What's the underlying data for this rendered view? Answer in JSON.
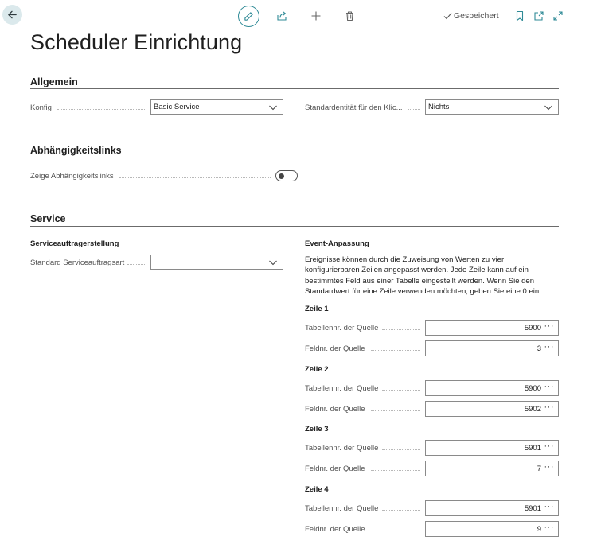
{
  "toolbar": {
    "saved_label": "Gespeichert"
  },
  "page": {
    "title": "Scheduler Einrichtung"
  },
  "sections": {
    "allgemein": {
      "title": "Allgemein",
      "konfig_label": "Konfig",
      "konfig_value": "Basic Service",
      "entity_label": "Standardentität für den Klic...",
      "entity_value": "Nichts"
    },
    "dependencies": {
      "title": "Abhängigkeitslinks",
      "show_label": "Zeige Abhängigkeitslinks",
      "show_value": false
    },
    "service": {
      "title": "Service",
      "order_heading": "Serviceauftragerstellung",
      "order_type_label": "Standard Serviceauftragsart",
      "order_type_value": "",
      "event_heading": "Event-Anpassung",
      "event_description": "Ereignisse können durch die Zuweisung von Werten zu vier konfigurierbaren Zeilen angepasst werden. Jede Zeile kann auf ein bestimmtes Feld aus einer Tabelle eingestellt werden. Wenn Sie den Standardwert für eine Zeile verwenden möchten, geben Sie eine 0 ein.",
      "rows": [
        {
          "heading": "Zeile 1",
          "table_label": "Tabellennr. der Quelle",
          "table_value": "5900",
          "field_label": "Feldnr. der Quelle",
          "field_value": "3"
        },
        {
          "heading": "Zeile 2",
          "table_label": "Tabellennr. der Quelle",
          "table_value": "5900",
          "field_label": "Feldnr. der Quelle",
          "field_value": "5902"
        },
        {
          "heading": "Zeile 3",
          "table_label": "Tabellennr. der Quelle",
          "table_value": "5901",
          "field_label": "Feldnr. der Quelle",
          "field_value": "7"
        },
        {
          "heading": "Zeile 4",
          "table_label": "Tabellennr. der Quelle",
          "table_value": "5901",
          "field_label": "Feldnr. der Quelle",
          "field_value": "9"
        }
      ]
    }
  }
}
